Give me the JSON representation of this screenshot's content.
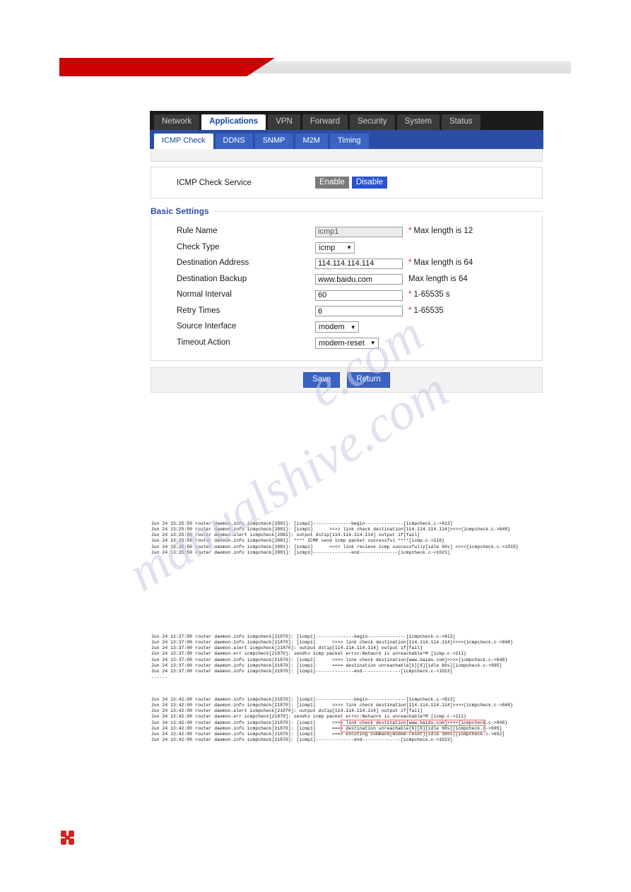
{
  "header": {
    "brand_band": "#cc0000",
    "gray_bar": "#e6e6e6"
  },
  "nav": {
    "tabs": [
      {
        "label": "Network",
        "active": false
      },
      {
        "label": "Applications",
        "active": true
      },
      {
        "label": "VPN",
        "active": false
      },
      {
        "label": "Forward",
        "active": false
      },
      {
        "label": "Security",
        "active": false
      },
      {
        "label": "System",
        "active": false
      },
      {
        "label": "Status",
        "active": false
      }
    ],
    "subtabs": [
      {
        "label": "ICMP Check",
        "active": true
      },
      {
        "label": "DDNS",
        "active": false
      },
      {
        "label": "SNMP",
        "active": false
      },
      {
        "label": "M2M",
        "active": false
      },
      {
        "label": "Timing",
        "active": false
      }
    ]
  },
  "service": {
    "label": "ICMP Check Service",
    "enable_label": "Enable",
    "disable_label": "Disable",
    "selected": "Disable"
  },
  "basic_settings": {
    "title": "Basic Settings",
    "fields": [
      {
        "label": "Rule Name",
        "type": "text",
        "value": "icmp1",
        "readonly": true,
        "required": true,
        "hint": "Max length is 12"
      },
      {
        "label": "Check Type",
        "type": "select",
        "value": "icmp",
        "readonly": false,
        "required": false,
        "hint": ""
      },
      {
        "label": "Destination Address",
        "type": "text",
        "value": "114.114.114.114",
        "readonly": false,
        "required": true,
        "hint": "Max length is 64"
      },
      {
        "label": "Destination Backup",
        "type": "text",
        "value": "www.baidu.com",
        "readonly": false,
        "required": false,
        "hint": "Max length is 64"
      },
      {
        "label": "Normal Interval",
        "type": "text",
        "value": "60",
        "readonly": false,
        "required": true,
        "hint": "1-65535 s"
      },
      {
        "label": "Retry Times",
        "type": "text",
        "value": "6",
        "readonly": false,
        "required": true,
        "hint": "1-65535"
      },
      {
        "label": "Source Interface",
        "type": "select",
        "value": "modem",
        "readonly": false,
        "required": false,
        "hint": ""
      },
      {
        "label": "Timeout Action",
        "type": "select",
        "value": "modem-reset",
        "readonly": false,
        "required": false,
        "hint": ""
      }
    ]
  },
  "actions": {
    "save_label": "Save",
    "return_label": "Return"
  },
  "logs": {
    "block1": [
      "Jun 24 13:25:50 router daemon.info icmpcheck[2881]: [icmp1]--------------begin--------------[icmpcheck.c->813]",
      "Jun 24 13:25:50 router daemon.info icmpcheck[2881]: [icmp1]      >>>> link check destination[114.114.114.114]>>>>{icmpcheck.c->848}",
      "Jun 24 13:25:50 router daemon.alert icmpcheck[2881]: output dstip[114.114.114.114] output if[fail]",
      "Jun 24 13:25:50 router daemon.info icmpcheck[2881]: **** ICMP send icmp packet successful ****[icmp.c->218}",
      "Jun 24 13:25:50 router daemon.info icmpcheck[2881]: [icmp1]      <<<< link recieve icmp successfully[idle 60s] <<<<{icmpcheck.c->1015}",
      "Jun 24 13:25:50 router daemon.info icmpcheck[2881]: [icmp1]--------------end--------------[icmpcheck.c->1023]"
    ],
    "block2": [
      "Jun 24 13:37:00 router daemon.info icmpcheck[21870]: [icmp1]--------------begin--------------[icmpcheck.c->813]",
      "Jun 24 13:37:00 router daemon.info icmpcheck[21870]: [icmp1]      >>>> link check destination[114.114.114.114]>>>>{icmpcheck.c->848}",
      "Jun 24 13:37:00 router daemon.alert icmpcheck[21870]: output dstip[114.114.114.114] output if[fail]",
      "Jun 24 13:37:00 router daemon.err icmpcheck[21870]: sendto icmp packet error:Network is unreachable^M [icmp.c->211}",
      "Jun 24 13:37:00 router daemon.info icmpcheck[21870]: [icmp1]      >>>> link check destination[www.baidu.com]>>>>{icmpcheck.c->848}",
      "Jun 24 13:37:00 router daemon.info icmpcheck[21870]: [icmp1]      ==== destination unreachable[1][6][idle 60s][icmpcheck.c->995]",
      "Jun 24 13:37:00 router daemon.info icmpcheck[21870]: [icmp1]--------------end--------------[icmpcheck.c->1023]",
      "......"
    ],
    "block3": [
      "Jun 24 13:42:00 router daemon.info icmpcheck[21870]: [icmp1]--------------begin--------------[icmpcheck.c->813]",
      "Jun 24 13:42:00 router daemon.info icmpcheck[21870]: [icmp1]      >>>> link check destination[114.114.114.114]>>>>{icmpcheck.c->848}",
      "Jun 24 13:42:00 router daemon.alert icmpcheck[21870]: output dstip[114.114.114.114] output if[fail]",
      "Jun 24 13:42:00 router daemon.err icmpcheck[21870]: sendto icmp packet error:Network is unreachable^M [icmp.c->211}",
      "Jun 24 13:42:00 router daemon.info icmpcheck[21870]: [icmp1]      >>>> link check destination[www.baidu.com]>>>>{icmpcheck.c->848}",
      "Jun 24 13:42:00 router daemon.info icmpcheck[21870]: [icmp1]      ==== destination unreachable[6][6][idle 60s][icmpcheck.c->995]",
      "Jun 24 13:42:00 router daemon.info icmpcheck[21870]: [icmp1]      ==== excuting command[modem-reset][idle 360s]{icmpcheck.c->652]",
      "Jun 24 13:42:00 router daemon.info icmpcheck[21870]: [icmp1]--------------end--------------[icmpcheck.c->1023]"
    ],
    "separator": "......"
  },
  "watermark": {
    "line1": "manualshive.com",
    "line2": "e.com"
  }
}
